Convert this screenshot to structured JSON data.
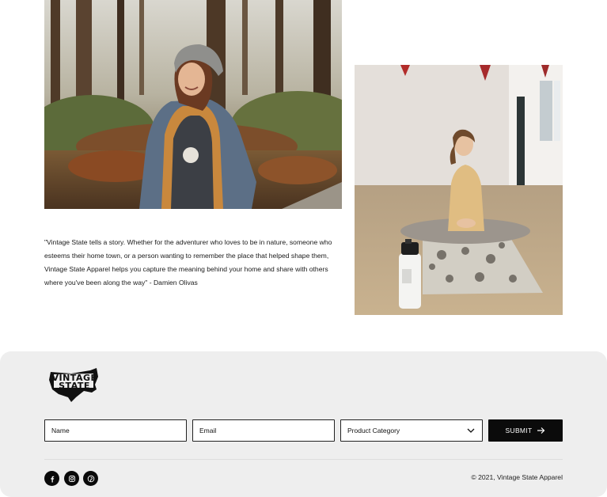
{
  "gallery": {
    "hiker_image_alt": "Woman in beanie and vest smiling in forest",
    "yoga_image_alt": "Woman stretching on yoga mat with water bottle"
  },
  "quote": {
    "text": "\"Vintage State tells a story. Whether for the adventurer who loves to be in nature, someone who esteems their home town, or a person wanting to remember the place that helped shape them, Vintage State Apparel helps you capture the meaning behind your home and share with others where you've been along the way\" - Damien Olivas"
  },
  "footer": {
    "logo": {
      "line1": "VINTAGE",
      "line2": "STATE"
    },
    "form": {
      "name_label": "Name",
      "email_label": "Email",
      "category_label": "Product Category",
      "submit_label": "SUBMIT"
    },
    "social": [
      "facebook-icon",
      "instagram-icon",
      "pinterest-icon"
    ],
    "copyright": "© 2021, Vintage State Apparel"
  },
  "colors": {
    "footer_bg": "#eeeeee",
    "button_bg": "#0b0b0b",
    "text": "#111111"
  }
}
